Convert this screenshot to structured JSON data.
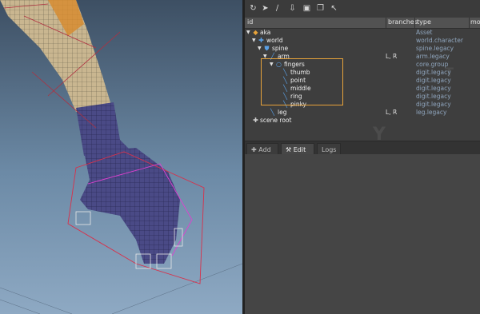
{
  "toolbar": {
    "icons": [
      "refresh-icon",
      "rocket-icon",
      "brush-icon",
      "import-icon",
      "trash-icon",
      "copy-icon",
      "select-arrow-icon"
    ]
  },
  "columns": {
    "id": "id",
    "branches": "branches",
    "type": "type",
    "mo": "mo"
  },
  "tree": [
    {
      "name": "aka",
      "branches": "",
      "type": "Asset",
      "icon": "asset-icon"
    },
    {
      "name": "world",
      "branches": "",
      "type": "world.character",
      "icon": "move-icon"
    },
    {
      "name": "spine",
      "branches": "",
      "type": "spine.legacy",
      "icon": "spine-icon"
    },
    {
      "name": "arm",
      "branches": "L, R",
      "type": "arm.legacy",
      "icon": "arm-icon"
    },
    {
      "name": "fingers",
      "branches": "",
      "type": "core.group",
      "icon": "circle-icon"
    },
    {
      "name": "thumb",
      "branches": "",
      "type": "digit.legacy",
      "icon": "bone-icon"
    },
    {
      "name": "point",
      "branches": "",
      "type": "digit.legacy",
      "icon": "bone-icon"
    },
    {
      "name": "middle",
      "branches": "",
      "type": "digit.legacy",
      "icon": "bone-icon"
    },
    {
      "name": "ring",
      "branches": "",
      "type": "digit.legacy",
      "icon": "bone-icon"
    },
    {
      "name": "pinky",
      "branches": "",
      "type": "digit.legacy",
      "icon": "bone-icon"
    },
    {
      "name": "leg",
      "branches": "L, R",
      "type": "leg.legacy",
      "icon": "bone-icon"
    },
    {
      "name": "scene root",
      "branches": "",
      "type": "",
      "icon": "move-icon"
    }
  ],
  "tabs": [
    {
      "label": "Add",
      "icon": "plus-icon"
    },
    {
      "label": "Edit",
      "icon": "tools-icon"
    },
    {
      "label": "Logs",
      "icon": ""
    }
  ],
  "colors": {
    "highlight": "#e8a33a",
    "type_text": "#8fa5bd",
    "asset_icon": "#e8a33a",
    "node_icon": "#5aa0e6"
  }
}
